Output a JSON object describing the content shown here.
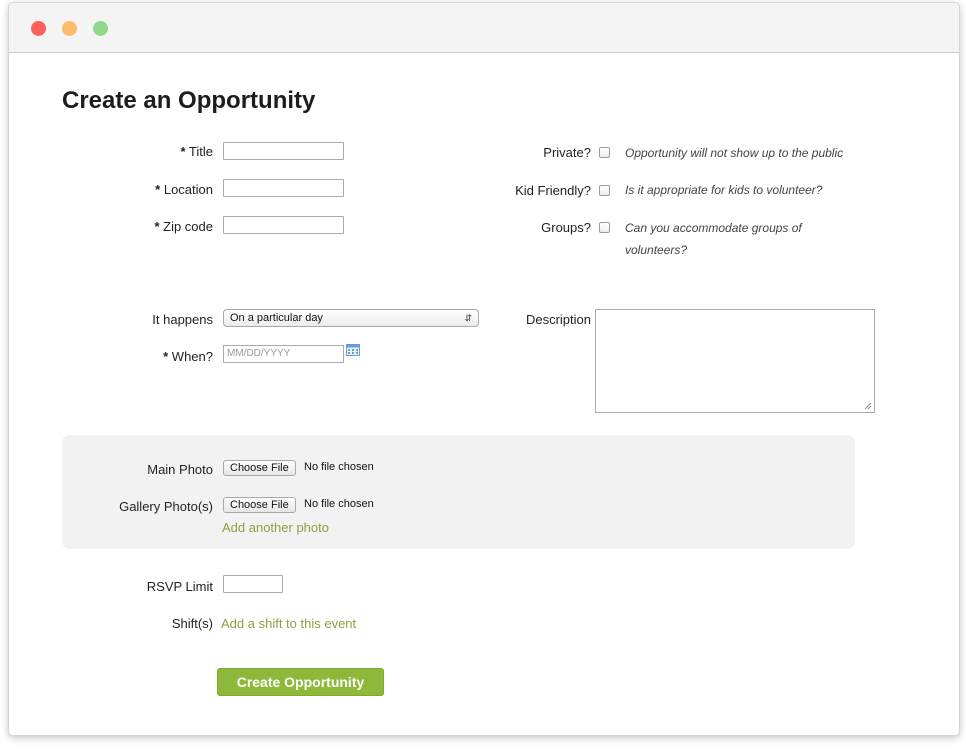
{
  "page": {
    "heading": "Create an Opportunity"
  },
  "form": {
    "title_label": "Title",
    "location_label": "Location",
    "zip_label": "Zip code",
    "required_marker": "*",
    "title_value": "",
    "location_value": "",
    "zip_value": "",
    "private_label": "Private?",
    "private_hint": "Opportunity will not show up to the public",
    "kid_label": "Kid Friendly?",
    "kid_hint": "Is it appropriate for kids to volunteer?",
    "groups_label": "Groups?",
    "groups_hint_line1": "Can you accommodate groups of",
    "groups_hint_line2": "volunteers?",
    "happens_label": "It happens",
    "happens_value": "On a particular day",
    "when_label": "When?",
    "when_placeholder": "MM/DD/YYYY",
    "description_label": "Description",
    "description_value": ""
  },
  "photos": {
    "main_label": "Main Photo",
    "gallery_label": "Gallery Photo(s)",
    "choose_file": "Choose File",
    "no_file": "No file chosen",
    "add_another": "Add another photo"
  },
  "extras": {
    "rsvp_label": "RSVP Limit",
    "rsvp_value": "",
    "shifts_label": "Shift(s)",
    "add_shift": "Add a shift to this event"
  },
  "actions": {
    "submit": "Create Opportunity"
  },
  "colors": {
    "accent": "#8db83a",
    "link": "#8aa342",
    "panel": "#f2f2f2"
  },
  "icons": {
    "when_picker": "calendar-icon",
    "happens_select": "updown-arrows-icon",
    "description_resize": "resize-grip-icon"
  }
}
